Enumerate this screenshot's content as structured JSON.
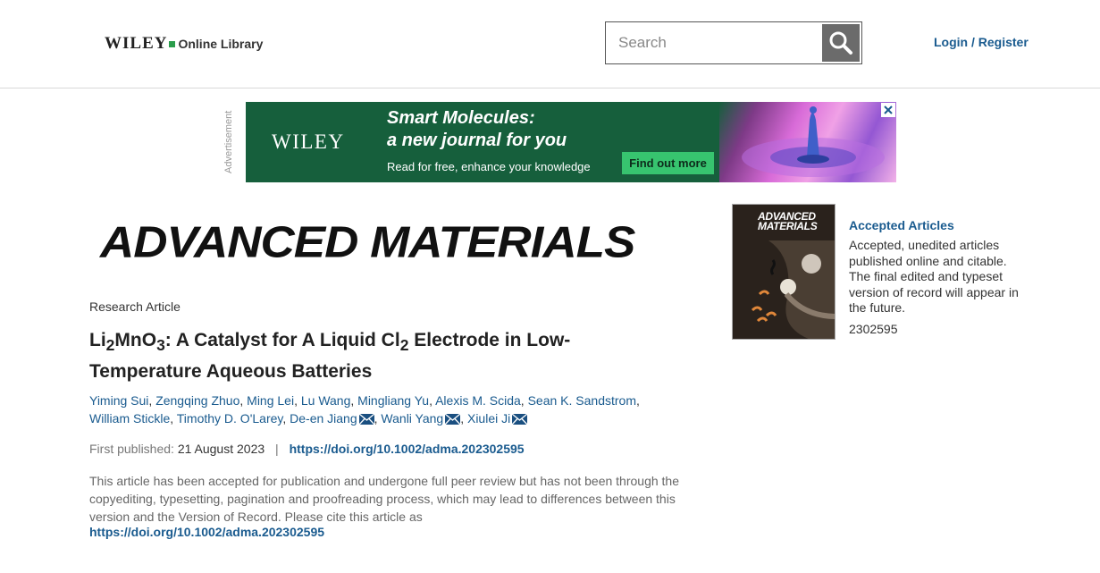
{
  "header": {
    "logo_wiley": "WILEY",
    "logo_online_library": "Online Library",
    "search_placeholder": "Search",
    "login_label": "Login / Register"
  },
  "ad": {
    "label": "Advertisement",
    "brand": "WILEY",
    "headline": "Smart Molecules:\na new journal for you",
    "subtext": "Read for free, enhance your knowledge",
    "cta": "Find out more"
  },
  "journal": {
    "name": "ADVANCED MATERIALS"
  },
  "article": {
    "type": "Research Article",
    "title_parts": [
      "Li",
      "2",
      "MnO",
      "3",
      ": A Catalyst for A Liquid Cl",
      "2",
      " Electrode in Low-Temperature Aqueous Batteries"
    ],
    "authors": [
      {
        "name": "Yiming Sui",
        "corresponding": false
      },
      {
        "name": "Zengqing Zhuo",
        "corresponding": false
      },
      {
        "name": "Ming Lei",
        "corresponding": false
      },
      {
        "name": "Lu Wang",
        "corresponding": false
      },
      {
        "name": "Mingliang Yu",
        "corresponding": false
      },
      {
        "name": "Alexis M. Scida",
        "corresponding": false
      },
      {
        "name": "Sean K. Sandstrom",
        "corresponding": false
      },
      {
        "name": "William Stickle",
        "corresponding": false
      },
      {
        "name": "Timothy D. O'Larey",
        "corresponding": false
      },
      {
        "name": "De-en Jiang",
        "corresponding": true
      },
      {
        "name": "Wanli Yang",
        "corresponding": true
      },
      {
        "name": "Xiulei Ji",
        "corresponding": true
      }
    ],
    "first_published_label": "First published:",
    "first_published_date": "21 August 2023",
    "separator": "|",
    "doi": "https://doi.org/10.1002/adma.202302595",
    "notice": "This article has been accepted for publication and undergone full peer review but has not been through the copyediting, typesetting, pagination and proofreading process, which may lead to differences between this version and the Version of Record. Please cite this article as",
    "notice_doi": "https://doi.org/10.1002/adma.202302595"
  },
  "sidebar": {
    "cover_title": "ADVANCED MATERIALS",
    "accepted_title": "Accepted Articles",
    "accepted_description": "Accepted, unedited articles published online and citable. The final edited and typeset version of record will appear in the future.",
    "article_number": "2302595"
  },
  "colors": {
    "link": "#1a5b8f",
    "ad_green": "#165f3c",
    "cta_green": "#37c46f",
    "search_button": "#6b6b6b"
  },
  "icons": [
    "search-icon",
    "close-icon",
    "envelope-icon"
  ]
}
